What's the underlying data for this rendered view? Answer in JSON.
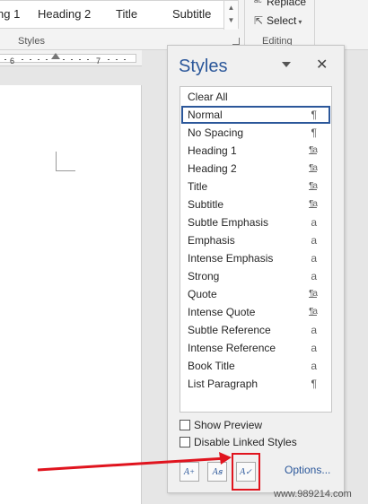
{
  "ribbon": {
    "gallery_items": [
      "ng 1",
      "Heading 2",
      "Title",
      "Subtitle"
    ],
    "styles_group_label": "Styles",
    "editing_group_label": "Editing",
    "replace_label": "Replace",
    "select_label": "Select"
  },
  "ruler": {
    "numbers": [
      "6",
      "7"
    ]
  },
  "styles_pane": {
    "title": "Styles",
    "close_icon": "close-icon",
    "items": [
      {
        "label": "Clear All",
        "mark": "",
        "selected": false
      },
      {
        "label": "Normal",
        "mark": "¶",
        "selected": true
      },
      {
        "label": "No Spacing",
        "mark": "¶",
        "selected": false
      },
      {
        "label": "Heading 1",
        "mark": "¶a",
        "selected": false
      },
      {
        "label": "Heading 2",
        "mark": "¶a",
        "selected": false
      },
      {
        "label": "Title",
        "mark": "¶a",
        "selected": false
      },
      {
        "label": "Subtitle",
        "mark": "¶a",
        "selected": false
      },
      {
        "label": "Subtle Emphasis",
        "mark": "a",
        "selected": false
      },
      {
        "label": "Emphasis",
        "mark": "a",
        "selected": false
      },
      {
        "label": "Intense Emphasis",
        "mark": "a",
        "selected": false
      },
      {
        "label": "Strong",
        "mark": "a",
        "selected": false
      },
      {
        "label": "Quote",
        "mark": "¶a",
        "selected": false
      },
      {
        "label": "Intense Quote",
        "mark": "¶a",
        "selected": false
      },
      {
        "label": "Subtle Reference",
        "mark": "a",
        "selected": false
      },
      {
        "label": "Intense Reference",
        "mark": "a",
        "selected": false
      },
      {
        "label": "Book Title",
        "mark": "a",
        "selected": false
      },
      {
        "label": "List Paragraph",
        "mark": "¶",
        "selected": false
      }
    ],
    "show_preview_label": "Show Preview",
    "show_preview_checked": false,
    "disable_linked_label": "Disable Linked Styles",
    "disable_linked_checked": false,
    "buttons": [
      {
        "name": "new-style-button",
        "icon": "new-style-icon"
      },
      {
        "name": "style-inspector-button",
        "icon": "style-inspector-icon"
      },
      {
        "name": "manage-styles-button",
        "icon": "manage-styles-icon"
      }
    ],
    "options_label": "Options..."
  },
  "annotation": {
    "arrow_color": "#e0141e",
    "highlight_color": "#e0141e"
  },
  "watermark": "www.989214.com",
  "colors": {
    "accent": "#2b579a",
    "ribbon_bg": "#f3f3f3",
    "pane_bg": "#f0f0f0"
  }
}
